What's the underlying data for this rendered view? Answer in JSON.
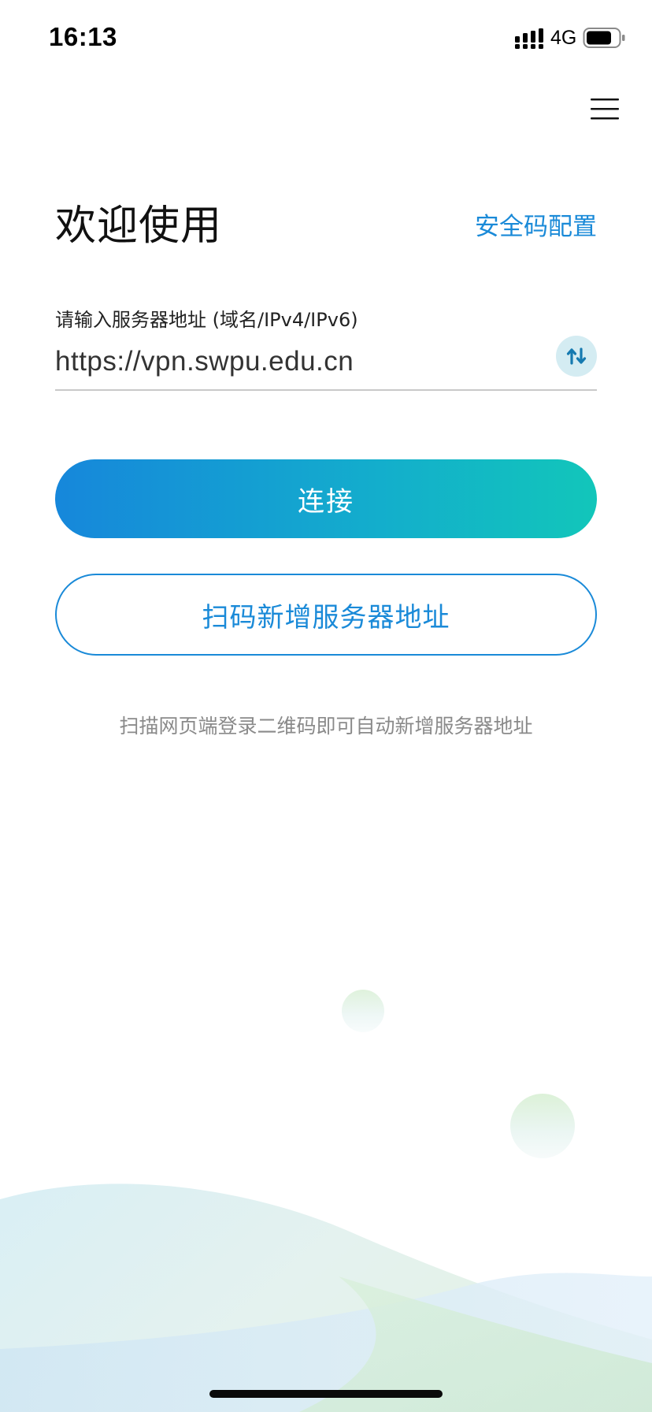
{
  "status_bar": {
    "time": "16:13",
    "network": "4G",
    "icons": [
      "signal-icon",
      "battery-icon"
    ]
  },
  "header": {
    "title": "欢迎使用",
    "security_link": "安全码配置",
    "menu_icon": "hamburger-menu-icon"
  },
  "address": {
    "label": "请输入服务器地址 (域名/IPv4/IPv6)",
    "value": "https://vpn.swpu.edu.cn",
    "switch_icon": "switch-arrows-icon"
  },
  "actions": {
    "connect_label": "连接",
    "scan_label": "扫码新增服务器地址"
  },
  "hint": "扫描网页端登录二维码即可自动新增服务器地址",
  "colors": {
    "accent": "#1a8ad8",
    "gradient_start": "#1687db",
    "gradient_end": "#12c6ba",
    "hint_text": "#8a8a8a"
  }
}
